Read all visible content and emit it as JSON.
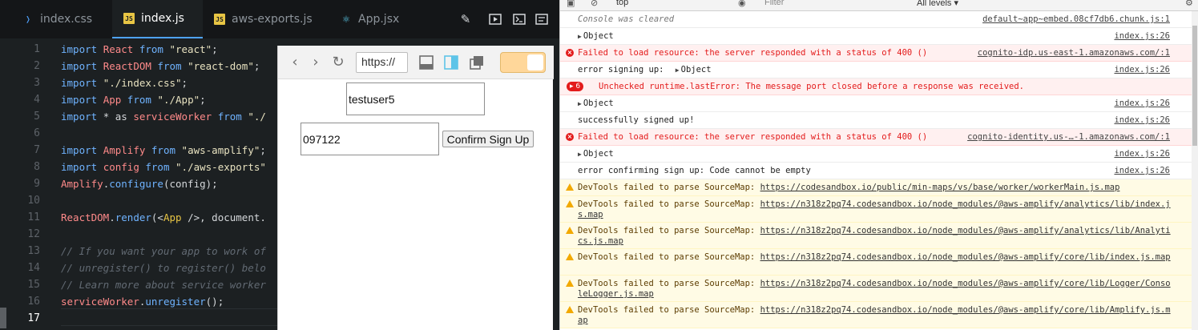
{
  "editor": {
    "tabs": [
      {
        "label": "index.css",
        "icon": "css-file-icon",
        "active": false
      },
      {
        "label": "index.js",
        "icon": "js-file-icon",
        "active": true
      },
      {
        "label": "aws-exports.js",
        "icon": "js-file-icon",
        "active": false
      },
      {
        "label": "App.jsx",
        "icon": "react-file-icon",
        "active": false
      }
    ],
    "toolbar_icons": [
      "brush-icon",
      "preview-panel-icon",
      "terminal-icon",
      "console-icon"
    ],
    "line_numbers": [
      "1",
      "2",
      "3",
      "4",
      "5",
      "6",
      "7",
      "8",
      "9",
      "10",
      "11",
      "12",
      "13",
      "14",
      "15",
      "16",
      "17"
    ],
    "current_line": "17",
    "code_lines": [
      [
        {
          "t": "import ",
          "c": "kw"
        },
        {
          "t": "React ",
          "c": "id"
        },
        {
          "t": "from ",
          "c": "kw"
        },
        {
          "t": "\"react\"",
          "c": "str"
        },
        {
          "t": ";",
          "c": ""
        }
      ],
      [
        {
          "t": "import ",
          "c": "kw"
        },
        {
          "t": "ReactDOM ",
          "c": "id"
        },
        {
          "t": "from ",
          "c": "kw"
        },
        {
          "t": "\"react-dom\"",
          "c": "str"
        },
        {
          "t": ";",
          "c": ""
        }
      ],
      [
        {
          "t": "import ",
          "c": "kw"
        },
        {
          "t": "\"./index.css\"",
          "c": "str"
        },
        {
          "t": ";",
          "c": ""
        }
      ],
      [
        {
          "t": "import ",
          "c": "kw"
        },
        {
          "t": "App ",
          "c": "id"
        },
        {
          "t": "from ",
          "c": "kw"
        },
        {
          "t": "\"./App\"",
          "c": "str"
        },
        {
          "t": ";",
          "c": ""
        }
      ],
      [
        {
          "t": "import ",
          "c": "kw"
        },
        {
          "t": "* as ",
          "c": ""
        },
        {
          "t": "serviceWorker ",
          "c": "id"
        },
        {
          "t": "from ",
          "c": "kw"
        },
        {
          "t": "\"./",
          "c": "str"
        }
      ],
      [],
      [
        {
          "t": "import ",
          "c": "kw"
        },
        {
          "t": "Amplify ",
          "c": "id"
        },
        {
          "t": "from ",
          "c": "kw"
        },
        {
          "t": "\"aws-amplify\"",
          "c": "str"
        },
        {
          "t": ";",
          "c": ""
        }
      ],
      [
        {
          "t": "import ",
          "c": "kw"
        },
        {
          "t": "config ",
          "c": "id"
        },
        {
          "t": "from ",
          "c": "kw"
        },
        {
          "t": "\"./aws-exports\"",
          "c": "str"
        }
      ],
      [
        {
          "t": "Amplify",
          "c": "id"
        },
        {
          "t": ".",
          "c": ""
        },
        {
          "t": "configure",
          "c": "kw"
        },
        {
          "t": "(config);",
          "c": ""
        }
      ],
      [],
      [
        {
          "t": "ReactDOM",
          "c": "id"
        },
        {
          "t": ".",
          "c": ""
        },
        {
          "t": "render",
          "c": "kw"
        },
        {
          "t": "(<",
          "c": ""
        },
        {
          "t": "App ",
          "c": "jsx"
        },
        {
          "t": "/>, document.",
          "c": ""
        }
      ],
      [],
      [
        {
          "t": "// If you want your app to work of",
          "c": "cmt"
        }
      ],
      [
        {
          "t": "// unregister() to register() belo",
          "c": "cmt"
        }
      ],
      [
        {
          "t": "// Learn more about service worker",
          "c": "cmt"
        }
      ],
      [
        {
          "t": "serviceWorker",
          "c": "id"
        },
        {
          "t": ".",
          "c": ""
        },
        {
          "t": "unregister",
          "c": "kw"
        },
        {
          "t": "();",
          "c": ""
        }
      ],
      []
    ]
  },
  "preview": {
    "url": "https://",
    "username_value": "testuser5",
    "code_value": "097122",
    "confirm_label": "Confirm Sign Up",
    "toggle_color": "#ffd79a"
  },
  "devtools": {
    "context": "top",
    "filter_placeholder": "Filter",
    "levels": "All levels ▾",
    "rows": [
      {
        "type": "info",
        "msg": "Console was cleared",
        "src": "default~app~embed.08cf7db6.chunk.js:1"
      },
      {
        "type": "log",
        "object": true,
        "msg": "Object",
        "src": "index.js:26"
      },
      {
        "type": "error",
        "msg": "Failed to load resource: the server responded with a status of 400 ()",
        "src": "cognito-idp.us-east-1.amazonaws.com/:1"
      },
      {
        "type": "log",
        "msg": "error signing up: ",
        "objsuffix": "Object",
        "src": "index.js:26"
      },
      {
        "type": "error",
        "badge": "6",
        "msg": "Unchecked runtime.lastError: The message port closed before a response was received.",
        "src": ""
      },
      {
        "type": "log",
        "object": true,
        "msg": "Object",
        "src": "index.js:26"
      },
      {
        "type": "log",
        "msg": "successfully signed up!",
        "src": "index.js:26"
      },
      {
        "type": "error",
        "msg": "Failed to load resource: the server responded with a status of 400 ()",
        "src": "cognito-identity.us-…-1.amazonaws.com/:1"
      },
      {
        "type": "log",
        "object": true,
        "msg": "Object",
        "src": "index.js:26"
      },
      {
        "type": "log",
        "msg": "error confirming sign up:  Code cannot be empty",
        "src": "index.js:26"
      },
      {
        "type": "warn",
        "msg": "DevTools failed to parse SourceMap: ",
        "link": "https://codesandbox.io/public/min-maps/vs/base/worker/workerMain.js.map",
        "lines": 1
      },
      {
        "type": "warn",
        "msg": "DevTools failed to parse SourceMap: ",
        "link": "https://n318z2pq74.codesandbox.io/node_modules/@aws-amplify/analytics/lib/index.js.map",
        "lines": 2
      },
      {
        "type": "warn",
        "msg": "DevTools failed to parse SourceMap: ",
        "link": "https://n318z2pq74.codesandbox.io/node_modules/@aws-amplify/analytics/lib/Analytics.js.map",
        "lines": 2
      },
      {
        "type": "warn",
        "msg": "DevTools failed to parse SourceMap: ",
        "link": "https://n318z2pq74.codesandbox.io/node_modules/@aws-amplify/core/lib/index.js.map",
        "lines": 2
      },
      {
        "type": "warn",
        "msg": "DevTools failed to parse SourceMap: ",
        "link": "https://n318z2pq74.codesandbox.io/node_modules/@aws-amplify/core/lib/Logger/ConsoleLogger.js.map",
        "lines": 2
      },
      {
        "type": "warn",
        "msg": "DevTools failed to parse SourceMap: ",
        "link": "https://n318z2pq74.codesandbox.io/node_modules/@aws-amplify/core/lib/Amplify.js.map",
        "lines": 2
      }
    ]
  }
}
